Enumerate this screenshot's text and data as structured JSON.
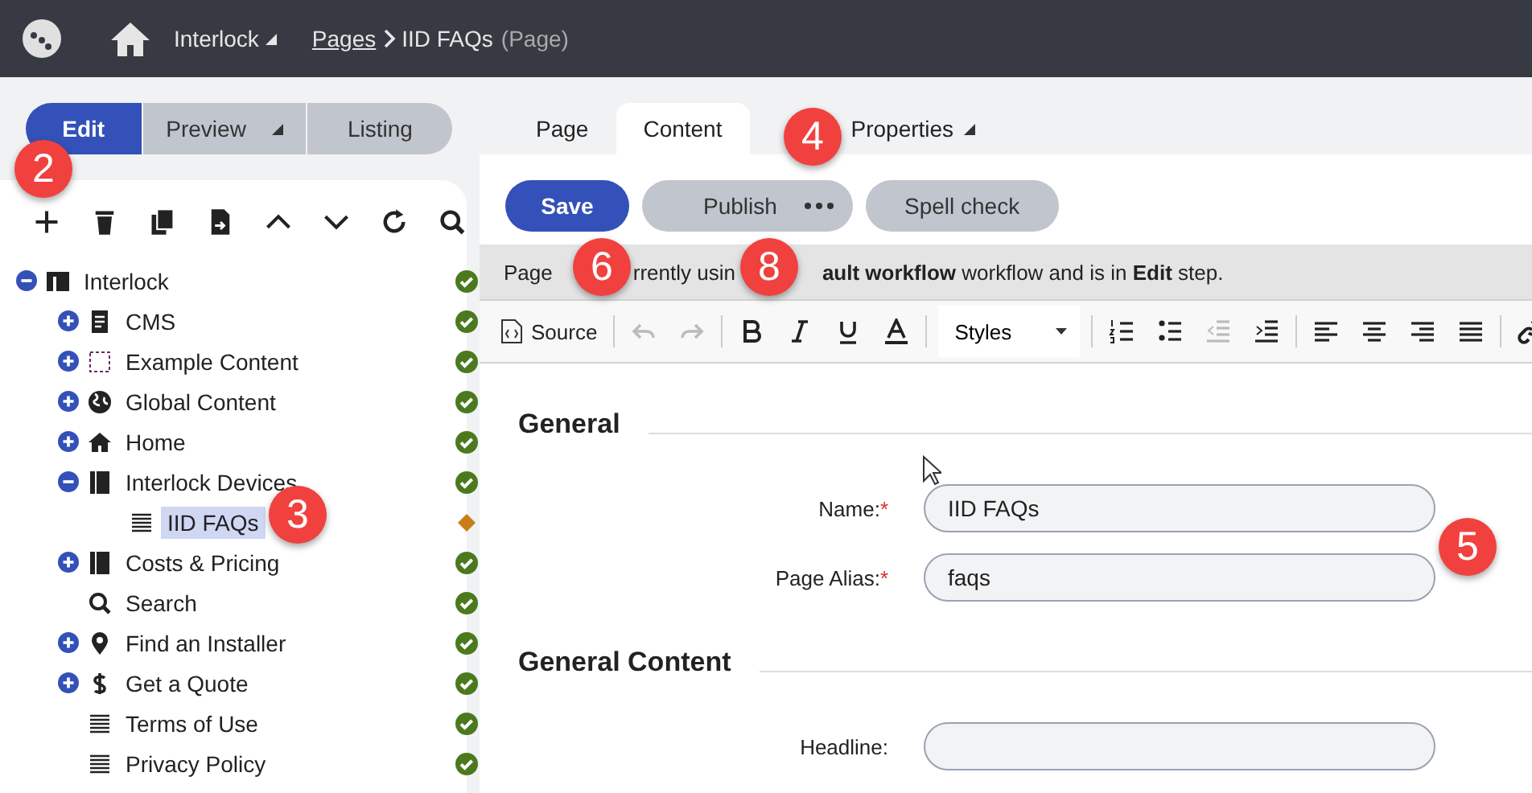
{
  "topbar": {
    "site": "Interlock",
    "breadcrumb_link": "Pages",
    "page_name": "IID FAQs",
    "page_type": "(Page)"
  },
  "mode_tabs": [
    {
      "label": "Edit",
      "selected": true,
      "menu": false
    },
    {
      "label": "Preview",
      "selected": false,
      "menu": true
    },
    {
      "label": "Listing",
      "selected": false,
      "menu": false
    }
  ],
  "tree": {
    "label": "Interlock",
    "kind": "layout",
    "expanded": true,
    "published": true,
    "selected": false,
    "children": [
      {
        "label": "CMS",
        "kind": "document",
        "expanded": false,
        "published": true,
        "selected": false
      },
      {
        "label": "Example Content",
        "kind": "dotted",
        "expanded": false,
        "published": true,
        "selected": false
      },
      {
        "label": "Global Content",
        "kind": "globe",
        "expanded": false,
        "published": true,
        "selected": false
      },
      {
        "label": "Home",
        "kind": "home",
        "expanded": false,
        "published": true,
        "selected": false
      },
      {
        "label": "Interlock Devices",
        "kind": "book",
        "expanded": true,
        "published": true,
        "selected": false,
        "children": [
          {
            "label": "IID FAQs",
            "kind": "lines",
            "published": false,
            "selected": true
          }
        ]
      },
      {
        "label": "Costs & Pricing",
        "kind": "book",
        "expanded": false,
        "published": true,
        "selected": false
      },
      {
        "label": "Search",
        "kind": "search",
        "published": true,
        "selected": false
      },
      {
        "label": "Find an Installer",
        "kind": "pin",
        "expanded": false,
        "published": true,
        "selected": false
      },
      {
        "label": "Get a Quote",
        "kind": "dollar",
        "expanded": false,
        "published": true,
        "selected": false
      },
      {
        "label": "Terms of Use",
        "kind": "lines",
        "published": true,
        "selected": false
      },
      {
        "label": "Privacy Policy",
        "kind": "lines",
        "published": true,
        "selected": false
      }
    ]
  },
  "content_tabs": [
    {
      "label": "Page",
      "selected": false,
      "menu": false
    },
    {
      "label": "Content",
      "selected": true,
      "menu": false
    },
    {
      "label": "Properties",
      "selected": false,
      "menu": true
    }
  ],
  "actions": {
    "save": "Save",
    "publish": "Publish",
    "spell_check": "Spell check"
  },
  "workflow_notice": [
    "Page",
    "rrently usin",
    "**ault workflow** workflow and is in **Edit** step."
  ],
  "editor_toolbar": [
    {
      "kind": "source",
      "label": "Source",
      "disabled": false
    },
    {
      "kind": "undo",
      "disabled": true
    },
    {
      "kind": "redo",
      "disabled": true
    },
    {
      "kind": "bold",
      "disabled": false
    },
    {
      "kind": "italic",
      "disabled": false
    },
    {
      "kind": "underline",
      "disabled": false
    },
    {
      "kind": "color",
      "disabled": false
    },
    {
      "kind": "styles",
      "label": "Styles",
      "disabled": false
    },
    {
      "kind": "numbered",
      "disabled": false
    },
    {
      "kind": "bulleted",
      "disabled": false
    },
    {
      "kind": "outdent",
      "disabled": true
    },
    {
      "kind": "indent",
      "disabled": false
    },
    {
      "kind": "align-left",
      "disabled": false
    },
    {
      "kind": "align-center",
      "disabled": false
    },
    {
      "kind": "align-right",
      "disabled": false
    },
    {
      "kind": "justify",
      "disabled": false
    },
    {
      "kind": "link",
      "disabled": false
    }
  ],
  "sections": [
    {
      "title": "General",
      "fields": [
        {
          "label": "Name:",
          "required_mark": "*",
          "value": "IID FAQs"
        },
        {
          "label": "Page Alias:",
          "required_mark": "*",
          "value": "faqs"
        }
      ]
    },
    {
      "title": "General Content",
      "fields": [
        {
          "label": "Headline:"
        }
      ]
    }
  ],
  "callouts": [
    "2",
    "3",
    "4",
    "5",
    "6",
    "8"
  ]
}
